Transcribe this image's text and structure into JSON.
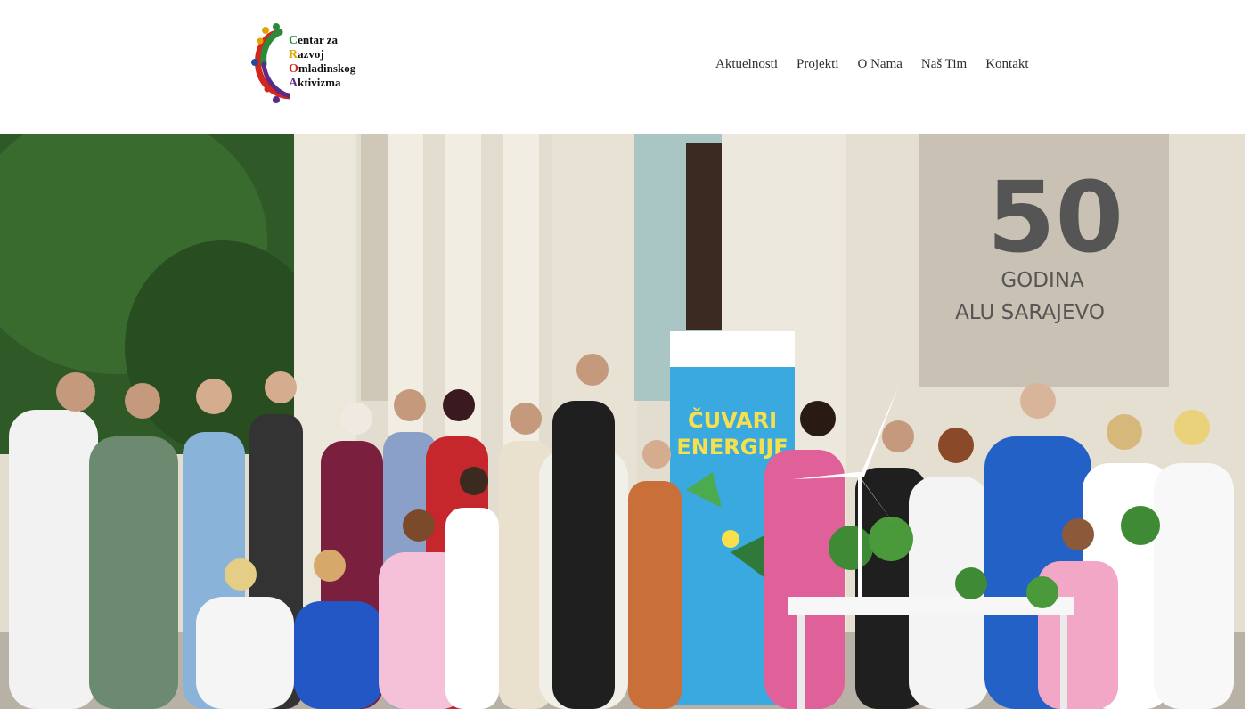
{
  "logo": {
    "line1": {
      "cap": "C",
      "rest": "entar za"
    },
    "line2": {
      "cap": "R",
      "rest": "azvoj"
    },
    "line3": {
      "cap": "O",
      "rest": "mladinskog"
    },
    "line4": {
      "cap": "A",
      "rest": "ktivizma"
    },
    "colors": [
      "#2a8a3a",
      "#e1a400",
      "#d2261f",
      "#5b2a86",
      "#1d4fa0"
    ]
  },
  "nav": {
    "items": [
      {
        "label": "Aktuelnosti"
      },
      {
        "label": "Projekti"
      },
      {
        "label": "O Nama"
      },
      {
        "label": "Naš Tim"
      },
      {
        "label": "Kontakt"
      }
    ]
  },
  "hero": {
    "wall_sign": {
      "number": "50",
      "line1": "GODINA",
      "line2": "ALU SARAJEVO"
    },
    "banner": {
      "line1": "ČUVARI",
      "line2": "ENERGIJE"
    },
    "colors": {
      "tree": "#2f5a27",
      "wall": "#e3ddcf",
      "banner": "#3aa9e0",
      "sign_plate": "#c9c1b3"
    }
  }
}
